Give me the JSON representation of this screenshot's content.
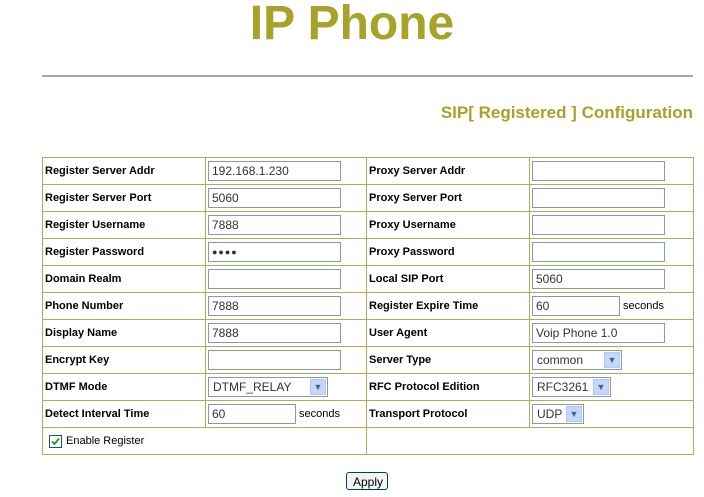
{
  "title": "IP Phone",
  "section_title": "SIP[ Registered ] Configuration",
  "rows": [
    {
      "l_label": "Register Server Addr",
      "l_value": "192.168.1.230",
      "r_label": "Proxy Server Addr",
      "r_value": ""
    },
    {
      "l_label": "Register Server Port",
      "l_value": "5060",
      "r_label": "Proxy Server Port",
      "r_value": ""
    },
    {
      "l_label": "Register Username",
      "l_value": "7888",
      "r_label": "Proxy Username",
      "r_value": ""
    },
    {
      "l_label": "Register Password",
      "l_value": "●●●●",
      "r_label": "Proxy Password",
      "r_value": ""
    },
    {
      "l_label": "Domain Realm",
      "l_value": "",
      "r_label": "Local SIP Port",
      "r_value": "5060"
    },
    {
      "l_label": "Phone Number",
      "l_value": "7888",
      "r_label": "Register Expire Time",
      "r_value": "60",
      "r_unit": "seconds"
    },
    {
      "l_label": "Display Name",
      "l_value": "7888",
      "r_label": "User Agent",
      "r_value": "Voip Phone 1.0"
    },
    {
      "l_label": "Encrypt Key",
      "l_value": "",
      "r_label": "Server Type",
      "r_value": "common"
    },
    {
      "l_label": "DTMF Mode",
      "l_value": "DTMF_RELAY",
      "r_label": "RFC Protocol Edition",
      "r_value": "RFC3261"
    },
    {
      "l_label": "Detect Interval Time",
      "l_value": "60",
      "l_unit": "seconds",
      "r_label": "Transport Protocol",
      "r_value": "UDP"
    }
  ],
  "enable_register": {
    "label": "Enable Register",
    "checked": true
  },
  "apply_label": "Apply"
}
